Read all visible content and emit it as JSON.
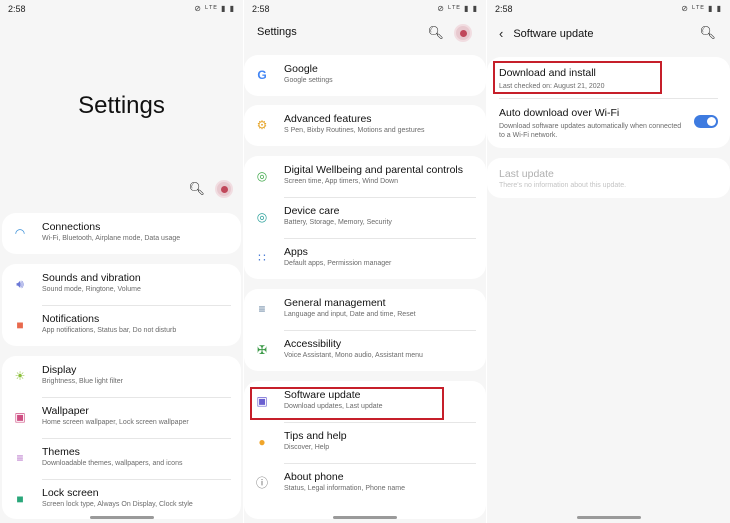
{
  "panel1": {
    "status": {
      "time": "2:58",
      "icons": "⊘ ᴸᵀᴱ ▮ ▮"
    },
    "title": "Settings",
    "header_icons": {
      "search": "search-icon",
      "avatar": "avatar"
    },
    "groups": [
      [
        {
          "title": "Connections",
          "subtitle": "Wi-Fi, Bluetooth, Airplane mode, Data usage",
          "icon": "wifi-icon",
          "color": "#3a8fd8"
        }
      ],
      [
        {
          "title": "Sounds and vibration",
          "subtitle": "Sound mode, Ringtone, Volume",
          "icon": "volume-icon",
          "color": "#6b78d6"
        },
        {
          "title": "Notifications",
          "subtitle": "App notifications, Status bar, Do not disturb",
          "icon": "notification-icon",
          "color": "#e86a4e"
        }
      ],
      [
        {
          "title": "Display",
          "subtitle": "Brightness, Blue light filter",
          "icon": "display-icon",
          "color": "#8bbf3a"
        },
        {
          "title": "Wallpaper",
          "subtitle": "Home screen wallpaper, Lock screen wallpaper",
          "icon": "wallpaper-icon",
          "color": "#cf4f83"
        },
        {
          "title": "Themes",
          "subtitle": "Downloadable themes, wallpapers, and icons",
          "icon": "themes-icon",
          "color": "#b065c4"
        },
        {
          "title": "Lock screen",
          "subtitle": "Screen lock type, Always On Display, Clock style",
          "icon": "lock-icon",
          "color": "#2aa77a"
        }
      ]
    ]
  },
  "panel2": {
    "status": {
      "time": "2:58",
      "icons": "⊘ ᴸᵀᴱ ▮ ▮"
    },
    "title": "Settings",
    "groups": [
      [
        {
          "title": "Google",
          "subtitle": "Google settings",
          "icon": "google-icon",
          "color": "#4285f4"
        }
      ],
      [
        {
          "title": "Advanced features",
          "subtitle": "S Pen, Bixby Routines, Motions and gestures",
          "icon": "advanced-features-icon",
          "color": "#e6a52a"
        }
      ],
      [
        {
          "title": "Digital Wellbeing and parental controls",
          "subtitle": "Screen time, App timers, Wind Down",
          "icon": "wellbeing-icon",
          "color": "#3fa84a"
        },
        {
          "title": "Device care",
          "subtitle": "Battery, Storage, Memory, Security",
          "icon": "device-care-icon",
          "color": "#2aa09a"
        },
        {
          "title": "Apps",
          "subtitle": "Default apps, Permission manager",
          "icon": "apps-icon",
          "color": "#4f7fd6"
        }
      ],
      [
        {
          "title": "General management",
          "subtitle": "Language and input, Date and time, Reset",
          "icon": "general-management-icon",
          "color": "#5a7a9a"
        },
        {
          "title": "Accessibility",
          "subtitle": "Voice Assistant, Mono audio, Assistant menu",
          "icon": "accessibility-icon",
          "color": "#3c9a48"
        }
      ],
      [
        {
          "title": "Software update",
          "subtitle": "Download updates, Last update",
          "icon": "software-update-icon",
          "color": "#6a5fd0"
        },
        {
          "title": "Tips and help",
          "subtitle": "Discover, Help",
          "icon": "tips-icon",
          "color": "#f0a52a"
        },
        {
          "title": "About phone",
          "subtitle": "Status, Legal information, Phone name",
          "icon": "info-icon",
          "color": "#6e6e6e"
        }
      ]
    ]
  },
  "panel3": {
    "status": {
      "time": "2:58",
      "icons": "⊘ ᴸᵀᴱ ▮ ▮"
    },
    "title": "Software update",
    "download": {
      "title": "Download and install",
      "subtitle": "Last checked on: August 21, 2020"
    },
    "auto": {
      "title": "Auto download over Wi-Fi",
      "subtitle": "Download software updates automatically when connected to a Wi-Fi network.",
      "enabled": true
    },
    "last": {
      "title": "Last update",
      "subtitle": "There's no information about this update."
    }
  },
  "colors": {
    "highlight": "#c61f2a",
    "toggle_on": "#3e7be0",
    "background": "#f6f6f6"
  }
}
